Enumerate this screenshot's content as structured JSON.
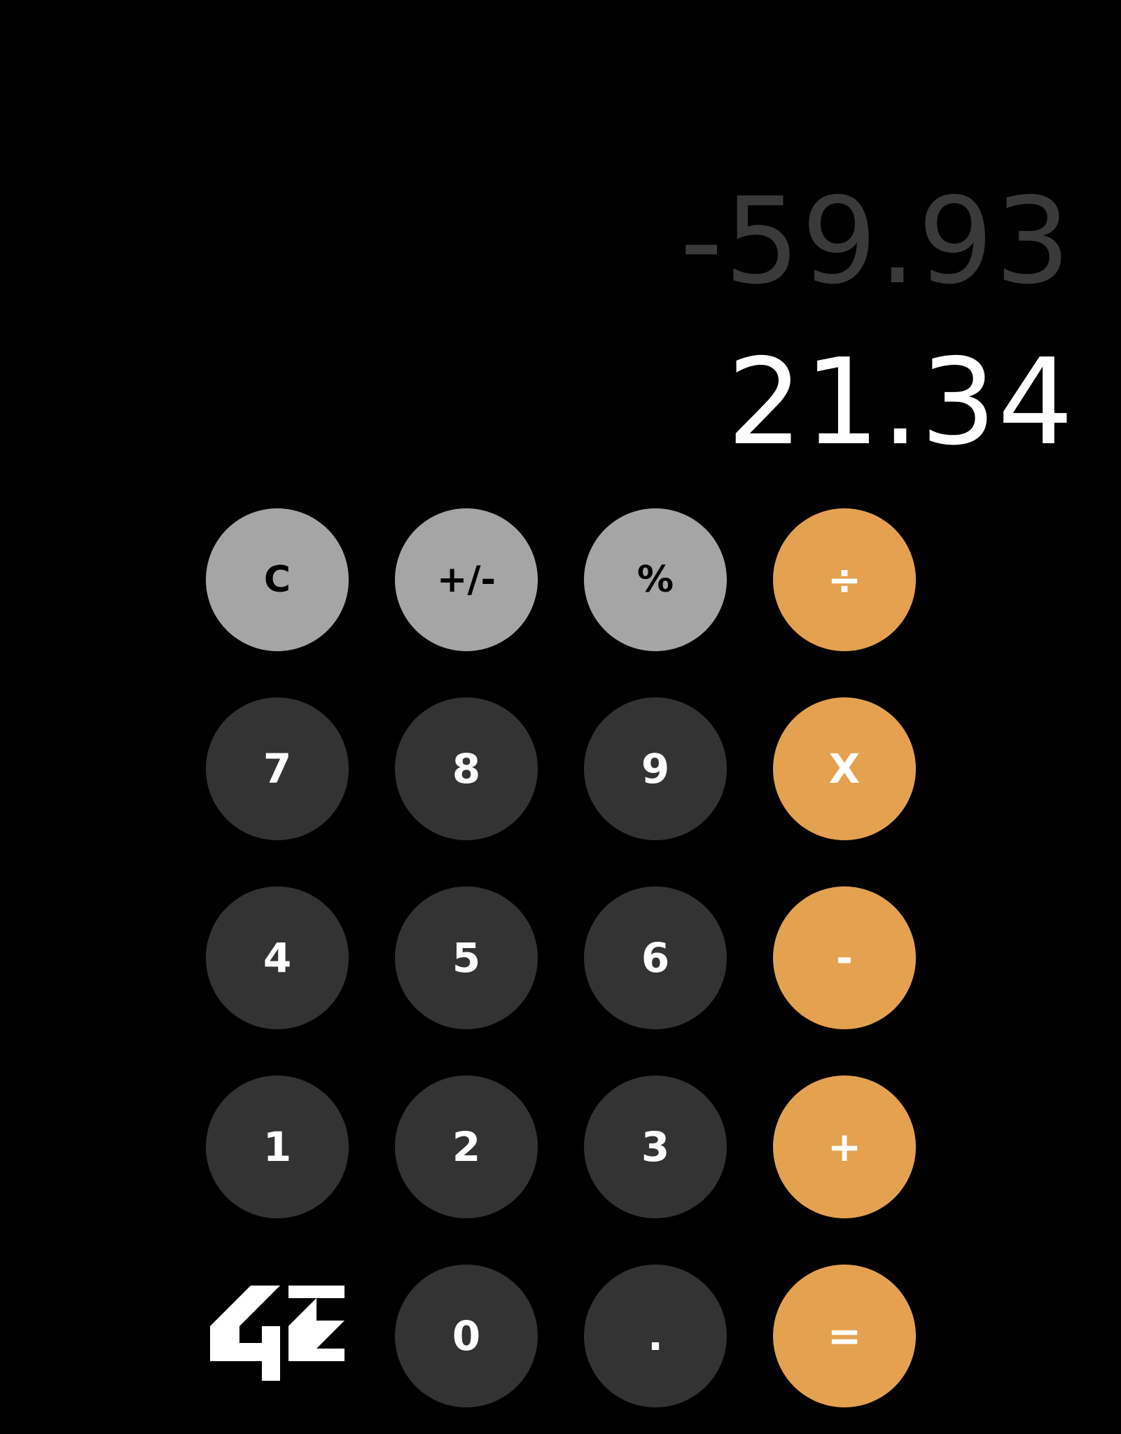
{
  "display": {
    "previous": "-59.93",
    "current": "21.34"
  },
  "keys": {
    "clear": "C",
    "sign": "+/-",
    "percent": "%",
    "divide": "÷",
    "seven": "7",
    "eight": "8",
    "nine": "9",
    "multiply": "X",
    "four": "4",
    "five": "5",
    "six": "6",
    "subtract": "-",
    "one": "1",
    "two": "2",
    "three": "3",
    "add": "+",
    "zero": "0",
    "decimal": ".",
    "equals": "="
  },
  "logo": {
    "text": "42",
    "icon": "school-42-logo"
  },
  "colors": {
    "background": "#000000",
    "function_key": "#a5a5a5",
    "number_key": "#333333",
    "operator_key": "#e4a14f",
    "previous_text": "#3a3a3a",
    "current_text": "#ffffff"
  }
}
